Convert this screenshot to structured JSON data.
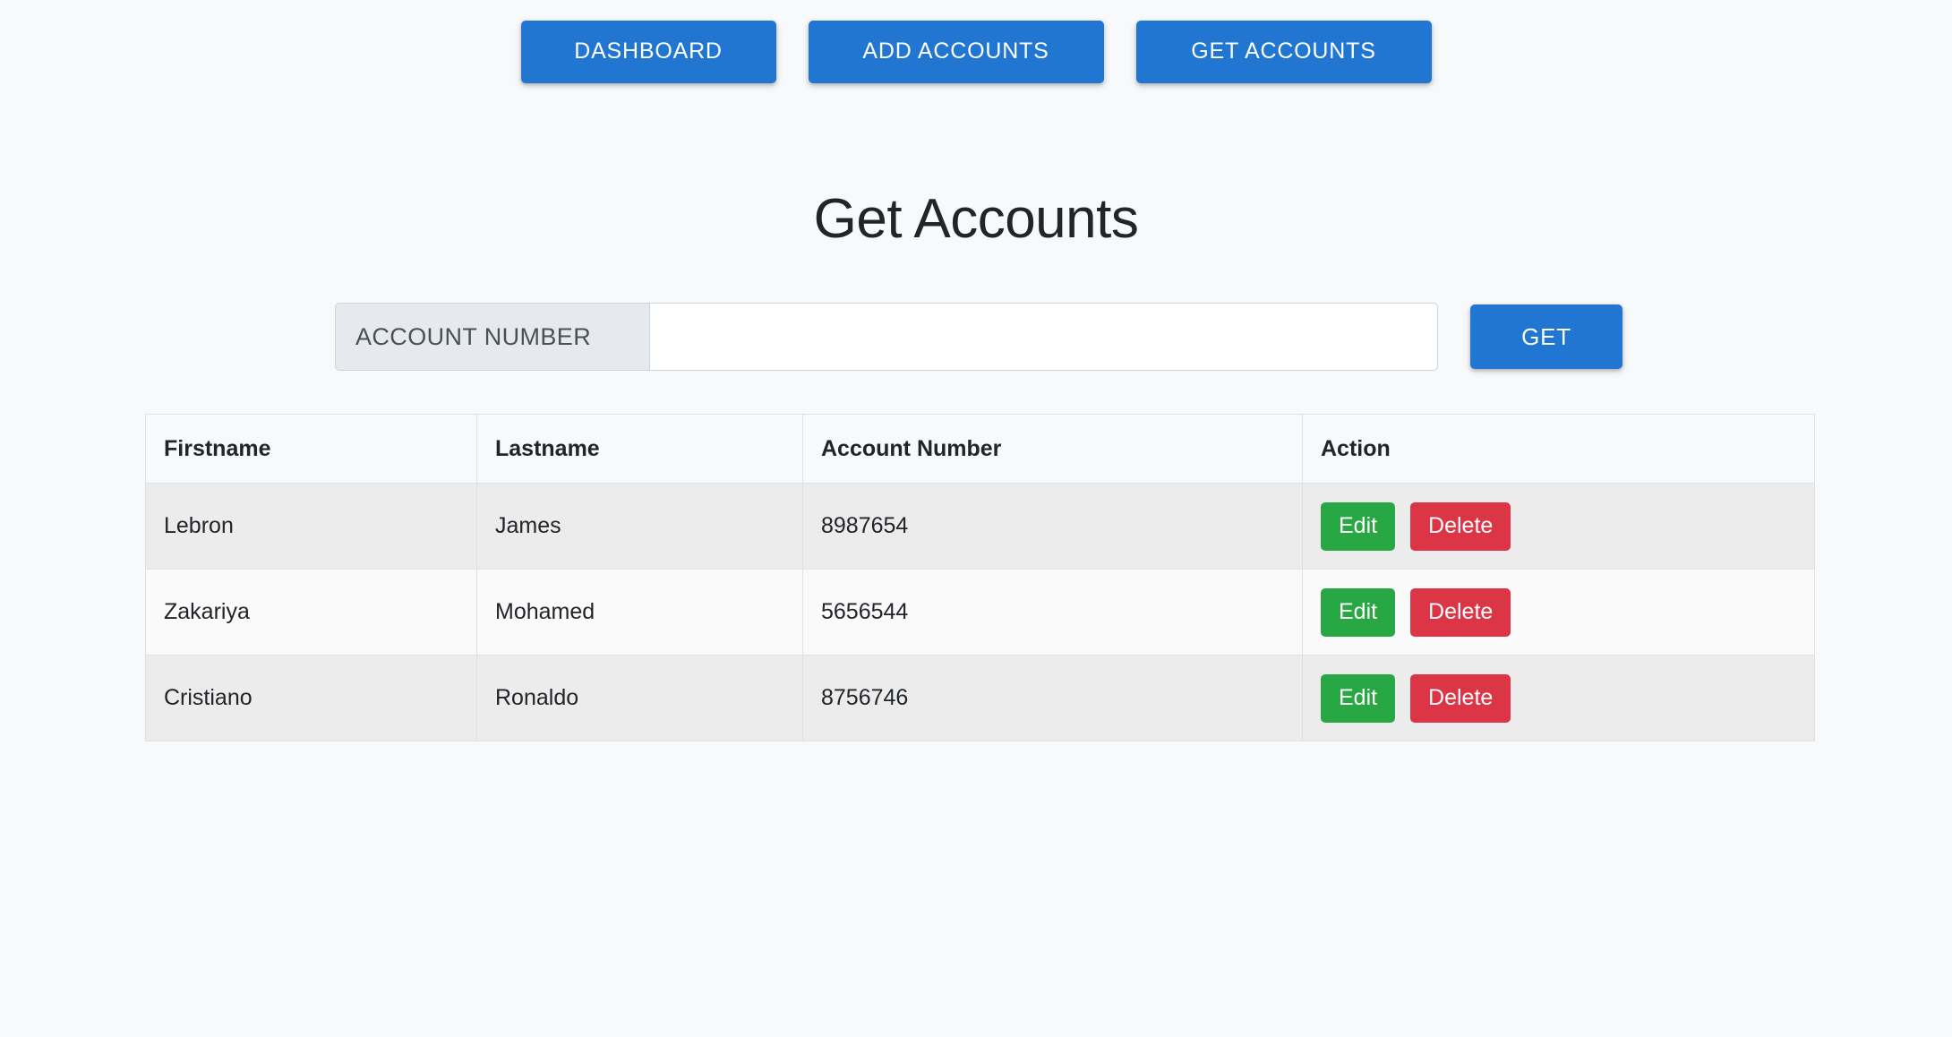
{
  "theme": {
    "page_background": "#f8f9fa",
    "primary_blue": "#2176d2",
    "edit_green": "#28a745",
    "delete_red": "#dc3545",
    "border_gray": "#dee2e6",
    "prepend_gray": "#e6eaee"
  },
  "navbar": {
    "items": [
      {
        "label": "DASHBOARD"
      },
      {
        "label": "ADD ACCOUNTS"
      },
      {
        "label": "GET ACCOUNTS"
      }
    ]
  },
  "page": {
    "title": "Get Accounts"
  },
  "search": {
    "prepend_label": "ACCOUNT NUMBER",
    "input_value": "",
    "input_placeholder": "",
    "submit_label": "GET"
  },
  "table": {
    "columns": [
      {
        "label": "Firstname"
      },
      {
        "label": "Lastname"
      },
      {
        "label": "Account Number"
      },
      {
        "label": "Action"
      }
    ],
    "rows": [
      {
        "firstname": "Lebron",
        "lastname": "James",
        "account_number": "8987654",
        "edit_label": "Edit",
        "delete_label": "Delete"
      },
      {
        "firstname": "Zakariya",
        "lastname": "Mohamed",
        "account_number": "5656544",
        "edit_label": "Edit",
        "delete_label": "Delete"
      },
      {
        "firstname": "Cristiano",
        "lastname": "Ronaldo",
        "account_number": "8756746",
        "edit_label": "Edit",
        "delete_label": "Delete"
      }
    ]
  }
}
